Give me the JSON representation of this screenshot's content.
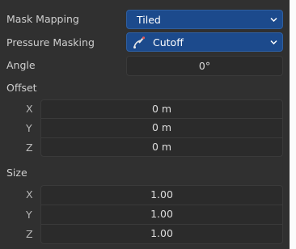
{
  "mask_mapping": {
    "label": "Mask Mapping",
    "value": "Tiled"
  },
  "pressure_masking": {
    "label": "Pressure Masking",
    "value": "Cutoff",
    "icon": "pressure-curve-icon"
  },
  "angle": {
    "label": "Angle",
    "value": "0°"
  },
  "offset": {
    "label": "Offset",
    "x": {
      "label": "X",
      "value": "0 m"
    },
    "y": {
      "label": "Y",
      "value": "0 m"
    },
    "z": {
      "label": "Z",
      "value": "0 m"
    }
  },
  "size": {
    "label": "Size",
    "x": {
      "label": "X",
      "value": "1.00"
    },
    "y": {
      "label": "Y",
      "value": "1.00"
    },
    "z": {
      "label": "Z",
      "value": "1.00"
    }
  },
  "colors": {
    "panel_bg": "#303030",
    "dropdown_bg": "#1c4a8c",
    "field_bg": "#2b2b2b",
    "text": "#cfcfcf"
  }
}
